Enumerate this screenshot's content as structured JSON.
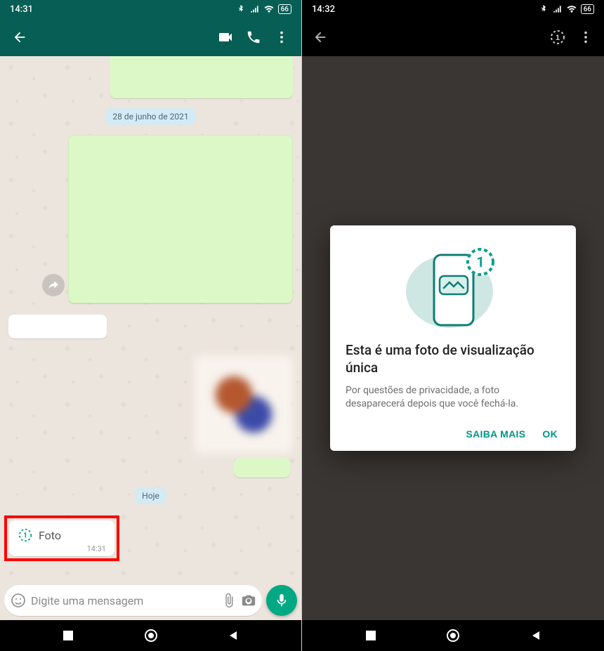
{
  "left": {
    "status_time": "14:31",
    "battery": "66",
    "date_chip_1": "28 de junho de 2021",
    "date_chip_today": "Hoje",
    "foto_bubble": {
      "label": "Foto",
      "time": "14:31"
    },
    "input_placeholder": "Digite uma mensagem"
  },
  "right": {
    "status_time": "14:32",
    "battery": "66",
    "dialog": {
      "title": "Esta é uma foto de visualização única",
      "body": "Por questões de privacidade, a foto desaparecerá depois que você fechá-la.",
      "learn_more": "SAIBA MAIS",
      "ok": "OK"
    }
  }
}
